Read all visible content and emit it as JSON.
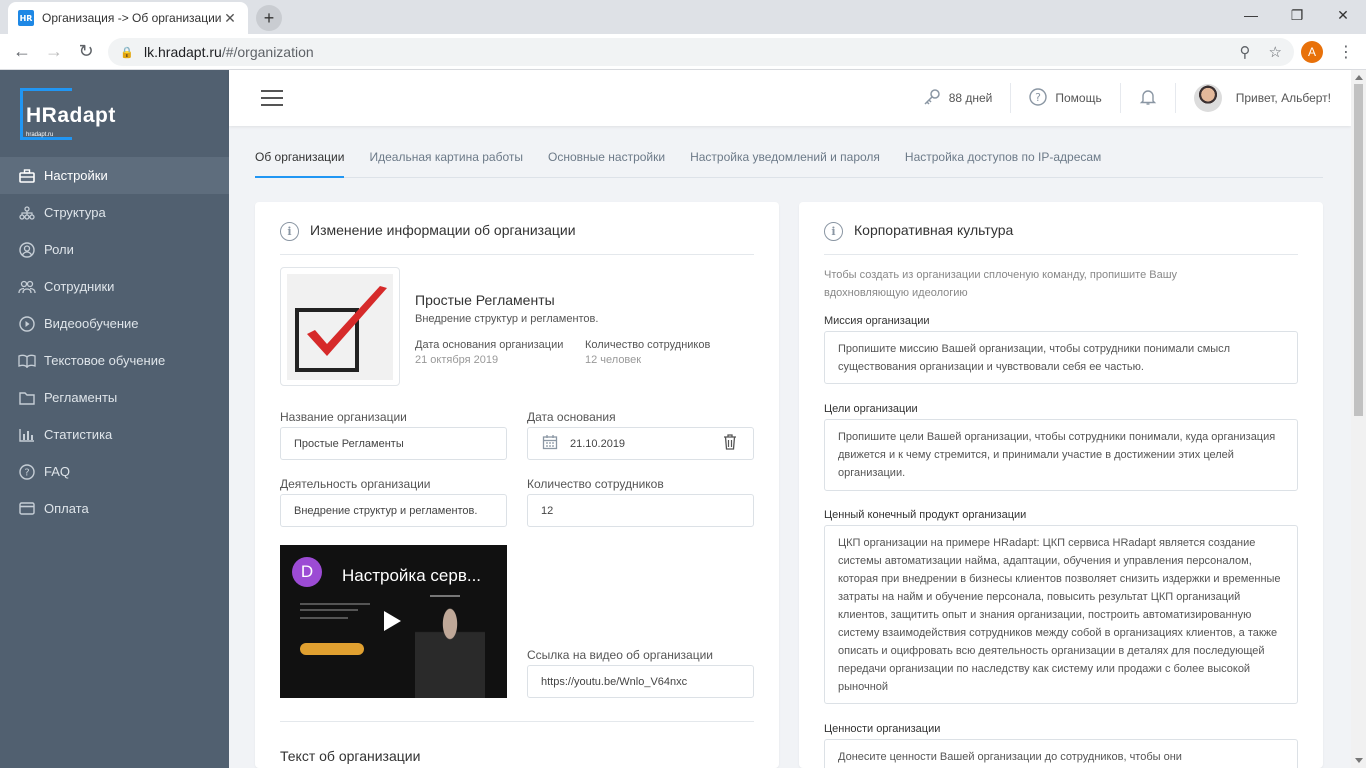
{
  "browser": {
    "tab_title": "Организация -> Об организации",
    "favicon_text": "HR",
    "url_host": "lk.hradapt.ru",
    "url_path": "/#/organization",
    "profile_initial": "A"
  },
  "sidebar": {
    "brand": "HRadapt",
    "brand_sub": "hradapt.ru",
    "items": [
      {
        "label": "Настройки",
        "icon": "briefcase-icon"
      },
      {
        "label": "Структура",
        "icon": "structure-icon"
      },
      {
        "label": "Роли",
        "icon": "user-circle-icon"
      },
      {
        "label": "Сотрудники",
        "icon": "users-icon"
      },
      {
        "label": "Видеообучение",
        "icon": "play-circle-icon"
      },
      {
        "label": "Текстовое обучение",
        "icon": "book-icon"
      },
      {
        "label": "Регламенты",
        "icon": "folder-icon"
      },
      {
        "label": "Статистика",
        "icon": "bar-chart-icon"
      },
      {
        "label": "FAQ",
        "icon": "question-circle-icon"
      },
      {
        "label": "Оплата",
        "icon": "credit-card-icon"
      }
    ]
  },
  "header": {
    "days": "88 дней",
    "help": "Помощь",
    "greeting": "Привет, Альберт!"
  },
  "tabs": [
    "Об организации",
    "Идеальная картина работы",
    "Основные настройки",
    "Настройка уведомлений и пароля",
    "Настройка доступов по IP-адресам"
  ],
  "left_card": {
    "title": "Изменение информации об организации",
    "org_name": "Простые Регламенты",
    "org_desc": "Внедрение структур и регламентов.",
    "founded_label": "Дата основания организации",
    "founded_value": "21 октября 2019",
    "employees_label": "Количество сотрудников",
    "employees_value": "12 человек",
    "name_label": "Название организации",
    "name_value": "Простые Регламенты",
    "date_label": "Дата основания",
    "date_value": "21.10.2019",
    "activity_label": "Деятельность организации",
    "activity_value": "Внедрение структур и регламентов.",
    "count_label": "Количество сотрудников",
    "count_value": "12",
    "video_avatar": "D",
    "video_title": "Настройка серв...",
    "video_link_label": "Ссылка на видео об организации",
    "video_link_value": "https://youtu.be/Wnlo_V64nxc",
    "about_title": "Текст об организации"
  },
  "right_card": {
    "title": "Корпоративная культура",
    "intro": "Чтобы создать из организации сплоченую команду, пропишите Вашу вдохновляющую идеологию",
    "mission_label": "Миссия организации",
    "mission_text": "Пропишите миссию Вашей организации, чтобы сотрудники понимали смысл существования организации и чувствовали себя ее частью.",
    "goals_label": "Цели организации",
    "goals_text": "Пропишите цели Вашей организации, чтобы сотрудники понимали, куда организация движется и к чему стремится, и принимали участие в достижении этих целей организации.",
    "ckp_label": "Ценный конечный продукт организации",
    "ckp_text": "ЦКП организации на примере HRadapt: ЦКП сервиса HRadapt является создание системы автоматизации найма, адаптации, обучения и управления персоналом, которая при внедрении в бизнесы клиентов позволяет снизить издержки и временные затраты на найм и обучение персонала, повысить результат ЦКП организаций клиентов, защитить опыт и знания организации, построить автоматизированную систему взаимодействия сотрудников между собой в организациях клиентов, а также описать и оцифровать всю деятельность организации в деталях для последующей передачи организации по наследству как систему или продажи с более высокой рыночной",
    "values_label": "Ценности организации",
    "values_text": "Донесите ценности Вашей организации до сотрудников, чтобы они"
  }
}
